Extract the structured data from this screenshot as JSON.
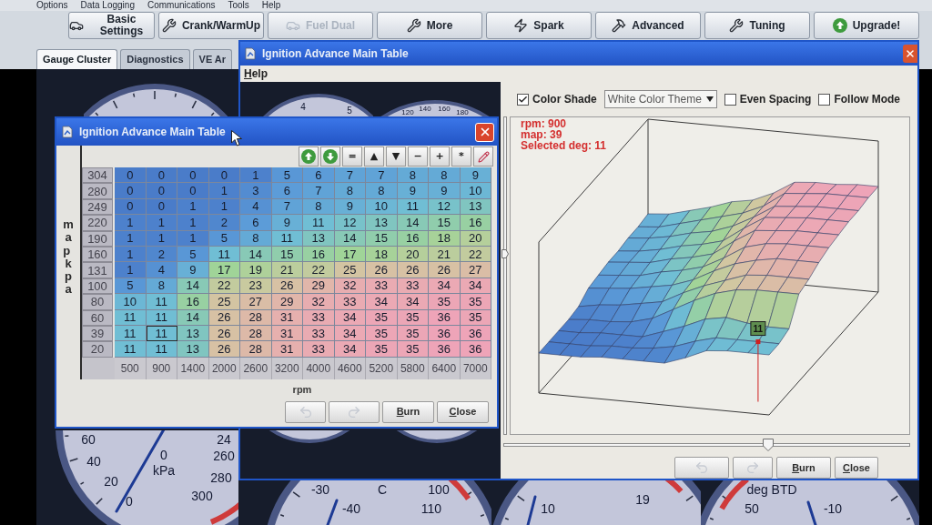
{
  "menu_bar": [
    "Options",
    "Data Logging",
    "Communications",
    "Tools",
    "Help"
  ],
  "toolbar": [
    {
      "label": "Basic Settings",
      "disabled": false
    },
    {
      "label": "Crank/WarmUp",
      "disabled": false
    },
    {
      "label": "Fuel Dual",
      "disabled": true
    },
    {
      "label": "More",
      "disabled": false
    },
    {
      "label": "Spark",
      "disabled": false
    },
    {
      "label": "Advanced",
      "disabled": false
    },
    {
      "label": "Tuning",
      "disabled": false
    },
    {
      "label": "Upgrade!",
      "disabled": false
    }
  ],
  "tabs": [
    {
      "label": "Gauge Cluster",
      "selected": true
    },
    {
      "label": "Diagnostics",
      "selected": false
    },
    {
      "label": "VE Ar",
      "selected": false
    }
  ],
  "gauges": [
    {
      "labels": [
        "60",
        "40",
        "20",
        "0",
        "0",
        "kPa",
        "24",
        "260",
        "280",
        "300"
      ]
    },
    {
      "labels": [
        "-30",
        "-40",
        "C",
        "100",
        "110"
      ]
    },
    {
      "labels": [
        "10",
        "19"
      ]
    },
    {
      "labels": [
        "deg BTD",
        "50",
        "-10"
      ]
    }
  ],
  "table_editor_window": {
    "title": "Ignition Advance Main Table",
    "menu": [
      "Help"
    ],
    "background_gauges": [
      {
        "labels": [
          "4",
          "5"
        ]
      },
      {
        "labels": [
          "120",
          "140",
          "160",
          "180"
        ]
      }
    ],
    "view_options": [
      {
        "kind": "checkbox",
        "label": "Color Shade",
        "checked": true
      },
      {
        "kind": "dropdown",
        "value": "White Color Theme"
      },
      {
        "kind": "checkbox",
        "label": "Even Spacing",
        "checked": false
      },
      {
        "kind": "checkbox",
        "label": "Follow Mode",
        "checked": false
      }
    ],
    "vertical_slider": {
      "level": 0.57
    },
    "surface_view": {
      "readout": [
        "rpm: 900",
        "map: 39",
        "Selected deg: 11"
      ],
      "marker_label": "11"
    },
    "horizontal_slider": {
      "level": 0.65
    },
    "buttons": [
      {
        "kind": "undo",
        "disabled": true
      },
      {
        "kind": "redo",
        "disabled": true
      },
      {
        "kind": "text",
        "label": "Burn",
        "disabled": false
      },
      {
        "kind": "text",
        "label": "Close",
        "disabled": false
      }
    ]
  },
  "table_dialog": {
    "title": "Ignition Advance Main Table",
    "tool_buttons": [
      "=",
      "▲",
      "▼",
      "−",
      "+",
      "*"
    ],
    "y_axis_label": "map kpa",
    "table": {
      "rows": [
        {
          "header": "304",
          "selected": false,
          "values": [
            "0",
            "0",
            "0",
            "0",
            "1",
            "5",
            "6",
            "7",
            "7",
            "8",
            "8",
            "9"
          ]
        },
        {
          "header": "280",
          "selected": false,
          "values": [
            "0",
            "0",
            "0",
            "1",
            "3",
            "6",
            "7",
            "8",
            "8",
            "9",
            "9",
            "10"
          ]
        },
        {
          "header": "249",
          "selected": false,
          "values": [
            "0",
            "0",
            "1",
            "1",
            "4",
            "7",
            "8",
            "9",
            "10",
            "11",
            "12",
            "13"
          ]
        },
        {
          "header": "220",
          "selected": false,
          "values": [
            "1",
            "1",
            "1",
            "2",
            "6",
            "9",
            "11",
            "12",
            "13",
            "14",
            "15",
            "16"
          ]
        },
        {
          "header": "190",
          "selected": false,
          "values": [
            "1",
            "1",
            "1",
            "5",
            "8",
            "11",
            "13",
            "14",
            "15",
            "16",
            "18",
            "20"
          ]
        },
        {
          "header": "160",
          "selected": false,
          "values": [
            "1",
            "2",
            "5",
            "11",
            "14",
            "15",
            "16",
            "17",
            "18",
            "20",
            "21",
            "22"
          ]
        },
        {
          "header": "131",
          "selected": false,
          "values": [
            "1",
            "4",
            "9",
            "17",
            "19",
            "21",
            "22",
            "25",
            "26",
            "26",
            "26",
            "27"
          ]
        },
        {
          "header": "100",
          "selected": false,
          "values": [
            "5",
            "8",
            "14",
            "22",
            "23",
            "26",
            "29",
            "32",
            "33",
            "33",
            "34",
            "34"
          ]
        },
        {
          "header": "80",
          "selected": false,
          "values": [
            "10",
            "11",
            "16",
            "25",
            "27",
            "29",
            "32",
            "33",
            "34",
            "34",
            "35",
            "35"
          ]
        },
        {
          "header": "60",
          "selected": false,
          "values": [
            "11",
            "11",
            "14",
            "26",
            "28",
            "31",
            "33",
            "34",
            "35",
            "35",
            "36",
            "35"
          ]
        },
        {
          "header": "39",
          "selected": true,
          "values": [
            "11",
            "11",
            "13",
            "26",
            "28",
            "31",
            "33",
            "34",
            "35",
            "35",
            "36",
            "36"
          ]
        },
        {
          "header": "20",
          "selected": false,
          "values": [
            "11",
            "11",
            "13",
            "26",
            "28",
            "31",
            "33",
            "34",
            "35",
            "35",
            "36",
            "36"
          ]
        }
      ],
      "columns": [
        {
          "label": "500",
          "selected": false
        },
        {
          "label": "900",
          "selected": true
        },
        {
          "label": "1400",
          "selected": false
        },
        {
          "label": "2000",
          "selected": false
        },
        {
          "label": "2600",
          "selected": false
        },
        {
          "label": "3200",
          "selected": false
        },
        {
          "label": "4000",
          "selected": false
        },
        {
          "label": "4600",
          "selected": false
        },
        {
          "label": "5200",
          "selected": false
        },
        {
          "label": "5800",
          "selected": false
        },
        {
          "label": "6400",
          "selected": false
        },
        {
          "label": "7000",
          "selected": false
        }
      ]
    },
    "x_axis_label": "rpm",
    "buttons": [
      {
        "kind": "undo",
        "disabled": true
      },
      {
        "kind": "redo",
        "disabled": true
      },
      {
        "kind": "text",
        "label": "Burn",
        "disabled": false
      },
      {
        "kind": "text",
        "label": "Close",
        "disabled": false
      }
    ]
  }
}
